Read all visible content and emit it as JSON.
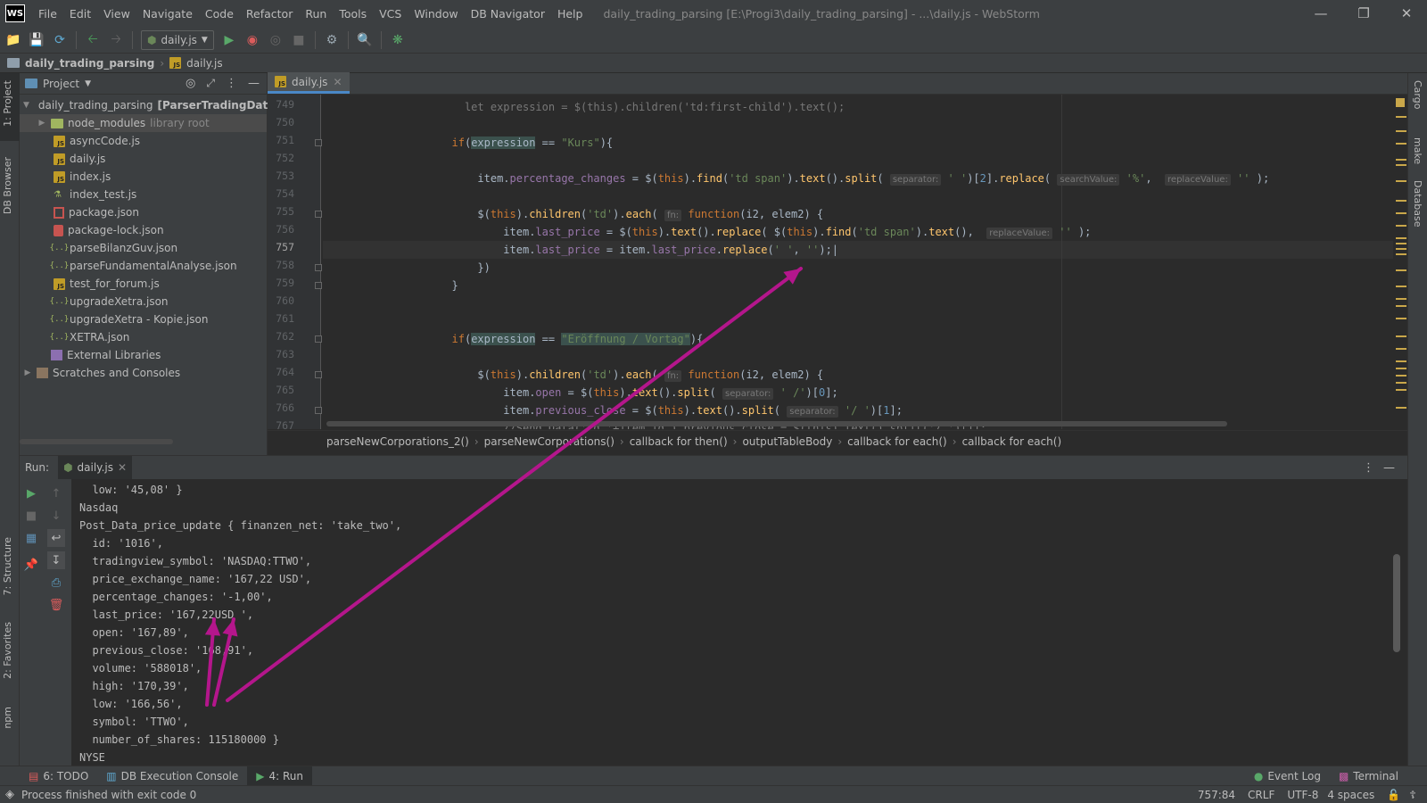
{
  "app_title": "daily_trading_parsing [E:\\Progi3\\daily_trading_parsing] - ...\\daily.js - WebStorm",
  "menu": [
    "File",
    "Edit",
    "View",
    "Navigate",
    "Code",
    "Refactor",
    "Run",
    "Tools",
    "VCS",
    "Window",
    "DB Navigator",
    "Help"
  ],
  "toolbar": {
    "run_config": "daily.js"
  },
  "nav": {
    "project": "daily_trading_parsing",
    "file": "daily.js"
  },
  "left_strip": {
    "project": "1: Project",
    "db_browser": "DB Browser",
    "structure": "7: Structure",
    "favorites": "2: Favorites",
    "npm": "npm"
  },
  "right_strip": {
    "cargo": "Cargo",
    "make": "make",
    "database": "Database"
  },
  "project_panel": {
    "title": "Project",
    "root": "daily_trading_parsing",
    "root_module": "[ParserTradingData]",
    "root_path": "E:",
    "items": [
      {
        "name": "node_modules",
        "extra": "library root"
      },
      {
        "name": "asyncCode.js"
      },
      {
        "name": "daily.js"
      },
      {
        "name": "index.js"
      },
      {
        "name": "index_test.js"
      },
      {
        "name": "package.json"
      },
      {
        "name": "package-lock.json"
      },
      {
        "name": "parseBilanzGuv.json"
      },
      {
        "name": "parseFundamentalAnalyse.json"
      },
      {
        "name": "test_for_forum.js"
      },
      {
        "name": "upgradeXetra.json"
      },
      {
        "name": "upgradeXetra - Kopie.json"
      },
      {
        "name": "XETRA.json"
      },
      {
        "name": "External Libraries"
      },
      {
        "name": "Scratches and Consoles"
      }
    ]
  },
  "editor": {
    "tab": "daily.js",
    "line_numbers": [
      "749",
      "750",
      "751",
      "752",
      "753",
      "754",
      "755",
      "756",
      "757",
      "758",
      "759",
      "760",
      "761",
      "762",
      "763",
      "764",
      "765",
      "766",
      "767"
    ],
    "current_line": "757",
    "hints": {
      "separator": "separator:",
      "searchValue": "searchValue:",
      "replaceValue": "replaceValue:",
      "fn": "fn:"
    }
  },
  "breadcrumbs": [
    "parseNewCorporations_2()",
    "parseNewCorporations()",
    "callback for then()",
    "outputTableBody",
    "callback for each()",
    "callback for each()"
  ],
  "run_panel": {
    "label": "Run:",
    "tab": "daily.js",
    "output": [
      "  low: '45,08' }",
      "Nasdaq",
      "Post_Data_price_update { finanzen_net: 'take_two',",
      "  id: '1016',",
      "  tradingview_symbol: 'NASDAQ:TTWO',",
      "  price_exchange_name: '167,22 USD',",
      "  percentage_changes: '-1,00',",
      "  last_price: '167,22USD ',",
      "  open: '167,89',",
      "  previous_close: '168,91',",
      "  volume: '588018',",
      "  high: '170,39',",
      "  low: '166,56',",
      "  symbol: 'TTWO',",
      "  number_of_shares: 115180000 }",
      "NYSE"
    ]
  },
  "bottom_tabs": {
    "todo": "6: TODO",
    "db_console": "DB Execution Console",
    "run": "4: Run",
    "event_log": "Event Log",
    "terminal": "Terminal"
  },
  "status": {
    "message": "Process finished with exit code 0",
    "position": "757:84",
    "line_sep": "CRLF",
    "encoding": "UTF-8",
    "indent": "4 spaces"
  },
  "colors": {
    "annotation": "#b4168c",
    "keyword": "#cc7832",
    "string": "#6a8759",
    "property": "#9876aa",
    "function": "#ffc66d"
  }
}
